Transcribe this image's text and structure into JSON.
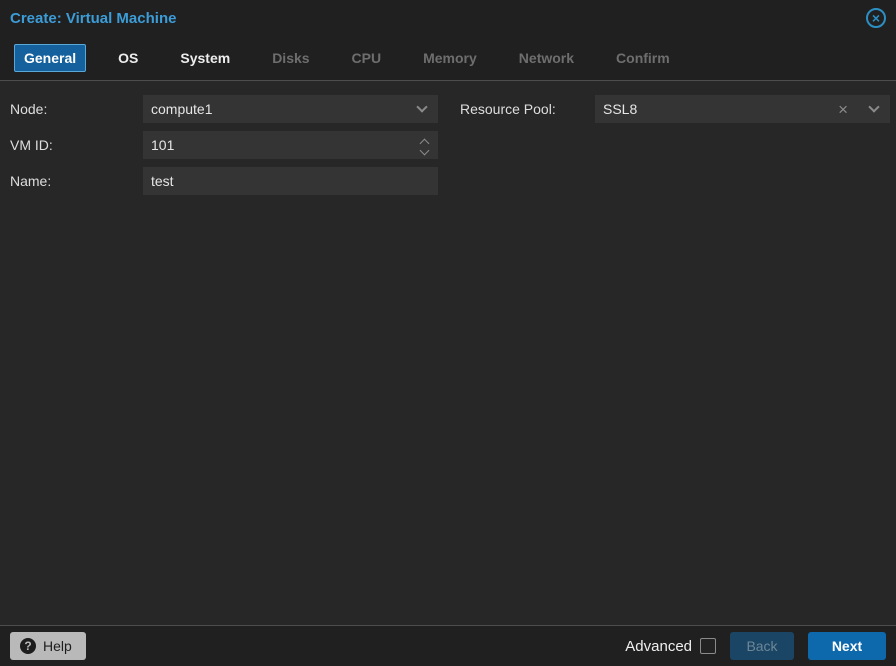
{
  "dialog": {
    "title": "Create: Virtual Machine"
  },
  "icons": {
    "close": "circle-x",
    "close_glyph": "×",
    "dropdown": "chevron-down",
    "spinner": "chevron-up-down",
    "clear": "x",
    "clear_glyph": "×",
    "help": "question-circle",
    "help_glyph": "?"
  },
  "tabs": [
    {
      "label": "General",
      "state": "active"
    },
    {
      "label": "OS",
      "state": "enabled"
    },
    {
      "label": "System",
      "state": "enabled"
    },
    {
      "label": "Disks",
      "state": "disabled"
    },
    {
      "label": "CPU",
      "state": "disabled"
    },
    {
      "label": "Memory",
      "state": "disabled"
    },
    {
      "label": "Network",
      "state": "disabled"
    },
    {
      "label": "Confirm",
      "state": "disabled"
    }
  ],
  "form": {
    "node": {
      "label": "Node:",
      "value": "compute1",
      "control": "combobox"
    },
    "vmid": {
      "label": "VM ID:",
      "value": "101",
      "control": "number-spinner"
    },
    "name": {
      "label": "Name:",
      "value": "test",
      "control": "text-input"
    },
    "resource_pool": {
      "label": "Resource Pool:",
      "value": "SSL8",
      "control": "combobox-clearable"
    }
  },
  "footer": {
    "help_label": "Help",
    "advanced_label": "Advanced",
    "advanced_checked": false,
    "back_label": "Back",
    "next_label": "Next"
  },
  "colors": {
    "accent_blue": "#3c9cd7",
    "active_tab_bg": "#14619e",
    "active_tab_border": "#5aa7d8",
    "next_button_bg": "#0d68ac",
    "back_button_bg": "#1a4565",
    "body_bg": "#272727",
    "chrome_bg": "#202020",
    "field_bg": "#343434"
  }
}
